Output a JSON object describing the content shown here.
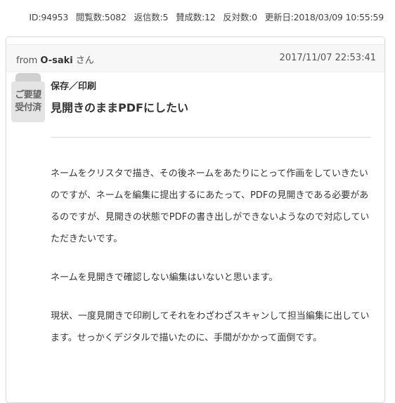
{
  "stats": {
    "id": "ID:94953",
    "views": "閲覧数:5082",
    "replies": "返信数:5",
    "agree": "賛成数:12",
    "oppose": "反対数:0",
    "updated": "更新日:2018/03/09 10:55:59"
  },
  "post": {
    "from_prefix": "from",
    "author": "O-saki",
    "honorific": "さん",
    "date": "2017/11/07 22:53:41",
    "badge": {
      "line1": "ご要望",
      "line2": "受付済",
      "icon": "clipboard-badge-icon"
    },
    "category": "保存／印刷",
    "title": "見開きのままPDFにしたい",
    "paragraphs": [
      "ネームをクリスタで描き、その後ネームをあたりにとって作画をしていきたいのですが、ネームを編集に提出するにあたって、PDFの見開きである必要があるのですが、見開きの状態でPDFの書き出しができないようなので対応していただきたいです。",
      "ネームを見開きで確認しない編集はいないと思います。",
      "現状、一度見開きで印刷してそれをわざわざスキャンして担当編集に出しています。せっかくデジタルで描いたのに、手間がかかって面倒です。"
    ]
  }
}
